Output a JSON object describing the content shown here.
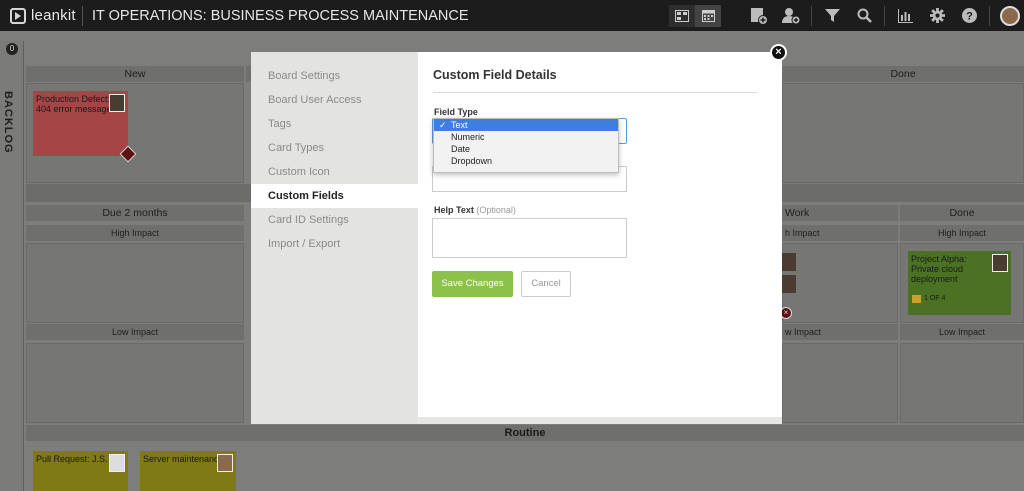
{
  "topbar": {
    "logo_text": "leankit",
    "board_title": "IT OPERATIONS: BUSINESS PROCESS MAINTENANCE",
    "icons": [
      "board-view-icon",
      "calendar-icon",
      "add-card-icon",
      "add-user-icon",
      "filter-icon",
      "search-icon",
      "analytics-icon",
      "settings-icon",
      "help-icon",
      "user-avatar"
    ]
  },
  "board": {
    "backlog_label": "BACKLOG",
    "backlog_count": "0",
    "top_lanes": {
      "new": "New",
      "done": "Done"
    },
    "mid_lanes": {
      "due": "Due 2 months",
      "work": "Work",
      "done": "Done"
    },
    "sublanes": {
      "high_left": "High Impact",
      "high_mid": "h Impact",
      "high_right": "High Impact",
      "low_left": "Low Impact",
      "low_mid": "w Impact",
      "low_right": "Low Impact"
    },
    "routine_label": "Routine",
    "cards": {
      "defect": "Production Defect: 404 error message",
      "project": "Project Alpha: Private cloud deployment",
      "project_progress": "1 OF 4",
      "pull_request": "Pull Request: J.S.",
      "server": "Server maintenance"
    }
  },
  "modal": {
    "nav_items": [
      "Board Settings",
      "Board User Access",
      "Tags",
      "Card Types",
      "Custom Icon",
      "Custom Fields",
      "Card ID Settings",
      "Import / Export"
    ],
    "active_nav": "Custom Fields",
    "title": "Custom Field Details",
    "field_type_label": "Field Type",
    "field_type_options": [
      "Text",
      "Numeric",
      "Date",
      "Dropdown"
    ],
    "field_type_selected": "Text",
    "help_text_label": "Help Text",
    "help_text_optional": "(Optional)",
    "save_label": "Save Changes",
    "cancel_label": "Cancel",
    "close_symbol": "×"
  },
  "colors": {
    "save_button": "#8bc34a",
    "selected_option": "#3d7fe0",
    "defect_card": "#a54545",
    "project_card": "#4b7223",
    "routine_card": "#7f7a16"
  }
}
